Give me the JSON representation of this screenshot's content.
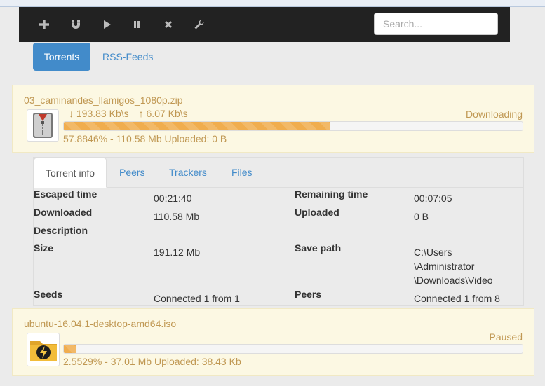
{
  "toolbar": {
    "icons": [
      "add-icon",
      "magnet-icon",
      "play-icon",
      "pause-icon",
      "remove-icon",
      "wrench-icon"
    ],
    "search_placeholder": "Search..."
  },
  "tabs": [
    {
      "label": "Torrents",
      "active": true
    },
    {
      "label": "RSS-Feeds",
      "active": false
    }
  ],
  "torrents": [
    {
      "name": "03_caminandes_llamigos_1080p.zip",
      "icon": "zip-archive-icon",
      "download_speed": "↓ 193.83 Kb\\s",
      "upload_speed": "↑ 6.07 Kb\\s",
      "status": "Downloading",
      "progress_fraction": 0.578846,
      "progress_text": "57.8846% - 110.58 Mb Uploaded: 0 B"
    },
    {
      "name": "ubuntu-16.04.1-desktop-amd64.iso",
      "icon": "folder-lightning-icon",
      "status": "Paused",
      "progress_fraction": 0.025529,
      "progress_text": "2.5529% - 37.01 Mb Uploaded: 38.43 Kb"
    }
  ],
  "details": {
    "tabs": [
      "Torrent info",
      "Peers",
      "Trackers",
      "Files"
    ],
    "escaped_time_label": "Escaped time",
    "escaped_time": "00:21:40",
    "remaining_time_label": "Remaining time",
    "remaining_time": "00:07:05",
    "downloaded_label": "Downloaded",
    "downloaded": "110.58 Mb",
    "uploaded_label": "Uploaded",
    "uploaded": "0 B",
    "description_label": "Description",
    "size_label": "Size",
    "size": "191.12 Mb",
    "save_path_label": "Save path",
    "save_path": [
      "C:\\Users",
      "\\Administrator",
      "\\Downloads\\Video"
    ],
    "seeds_label": "Seeds",
    "seeds": "Connected 1 from 1",
    "peers_label": "Peers",
    "peers": "Connected 1 from 8"
  },
  "colors": {
    "accent": "#428bca",
    "warning_text": "#c09853",
    "warning_bg": "#fcf8e3",
    "progress": "#f0ad4e",
    "toolbar_bg": "#222222"
  }
}
